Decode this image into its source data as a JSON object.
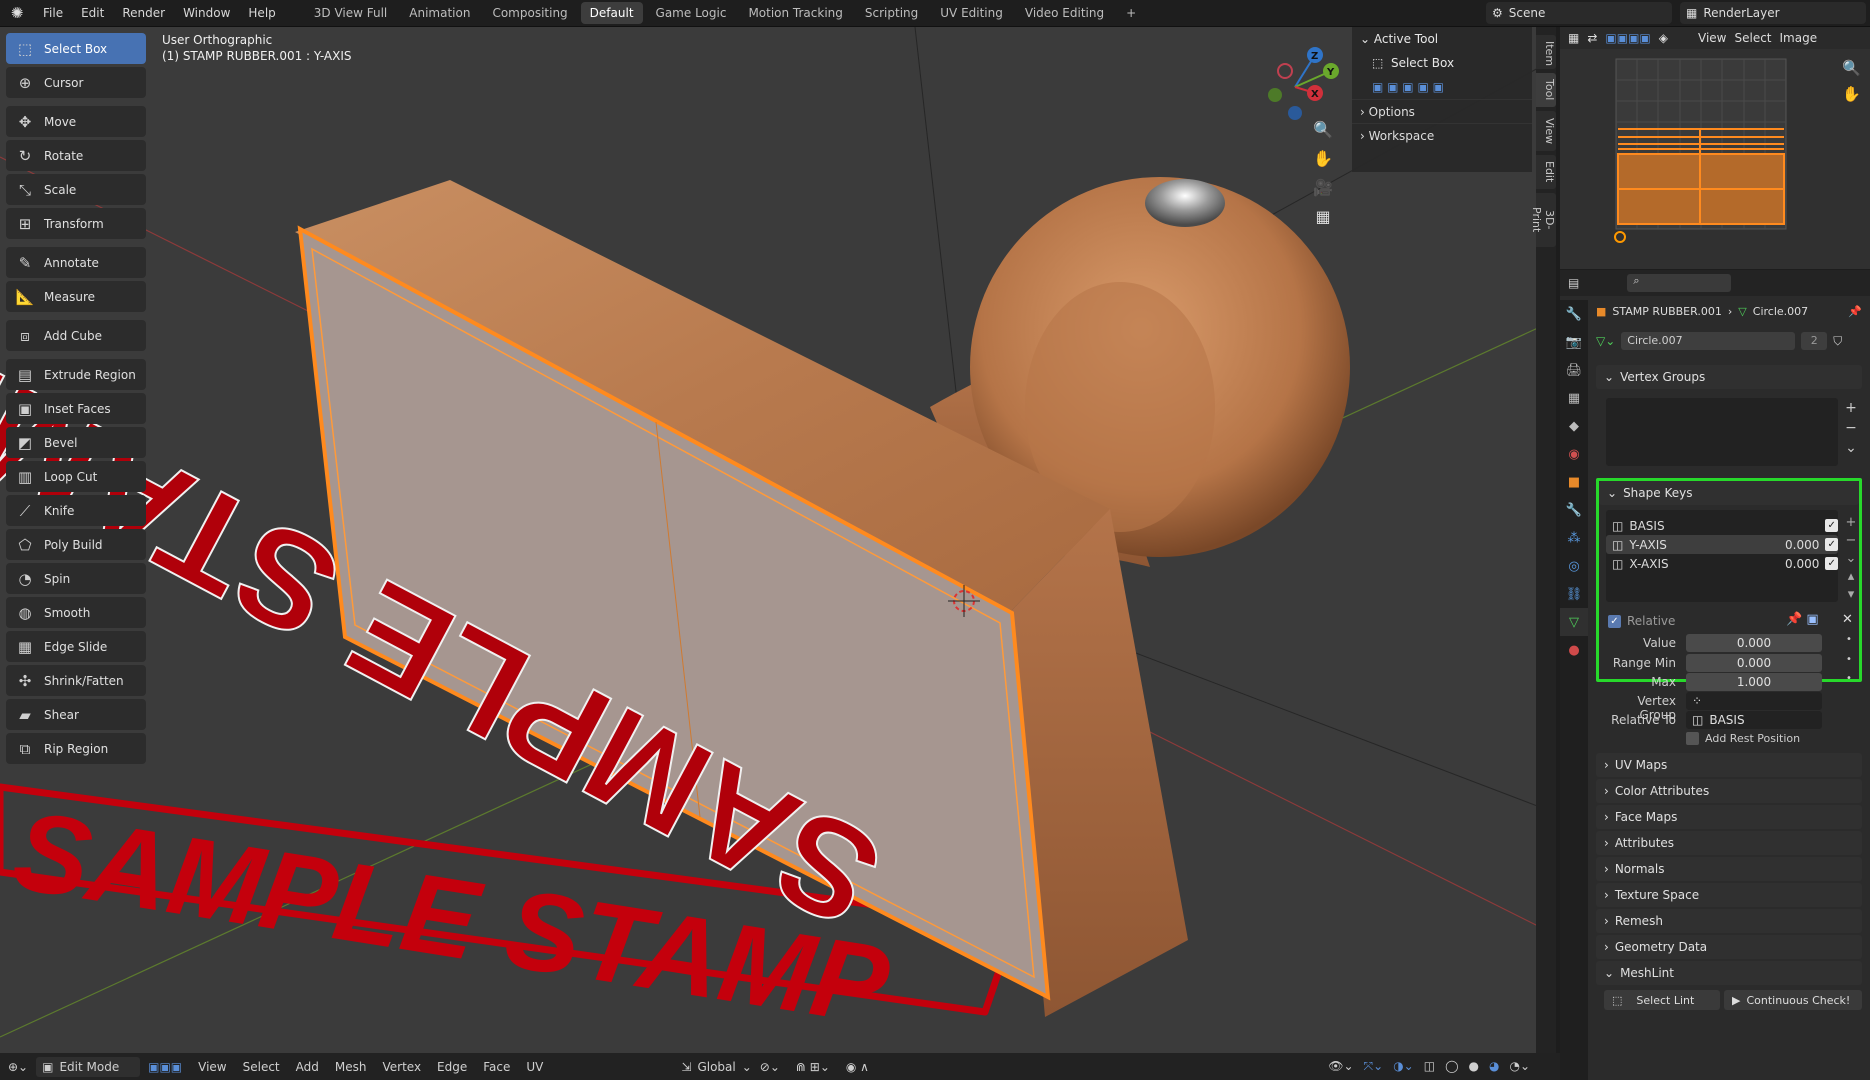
{
  "topbar": {
    "menus": [
      "File",
      "Edit",
      "Render",
      "Window",
      "Help"
    ],
    "workspaces": [
      "3D View Full",
      "Animation",
      "Compositing",
      "Default",
      "Game Logic",
      "Motion Tracking",
      "Scripting",
      "UV Editing",
      "Video Editing"
    ],
    "active_workspace": "Default",
    "add_tab": "+",
    "scene": "Scene",
    "render_layer": "RenderLayer"
  },
  "toolbar": {
    "tools": [
      "Select Box",
      "Cursor",
      "Move",
      "Rotate",
      "Scale",
      "Transform",
      "Annotate",
      "Measure",
      "Add Cube",
      "Extrude Region",
      "Inset Faces",
      "Bevel",
      "Loop Cut",
      "Knife",
      "Poly Build",
      "Spin",
      "Smooth",
      "Edge Slide",
      "Shrink/Fatten",
      "Shear",
      "Rip Region"
    ]
  },
  "viewport": {
    "view_name": "User Orthographic",
    "object_info": "(1) STAMP RUBBER.001 : Y-AXIS",
    "embossed_text": "SAMPLE STAMP",
    "ground_text": "SAMPLE STAMP",
    "gizmo": {
      "x": "X",
      "y": "Y",
      "z": "Z"
    }
  },
  "npanel": {
    "active_tool": "Active Tool",
    "tool_name": "Select Box",
    "options": "Options",
    "workspace": "Workspace"
  },
  "vtabs": [
    "Item",
    "Tool",
    "View",
    "Edit",
    "3D-Print"
  ],
  "uv": {
    "menus": [
      "View",
      "Select",
      "Image"
    ]
  },
  "props": {
    "breadcrumb_object": "STAMP RUBBER.001",
    "breadcrumb_mesh": "Circle.007",
    "mesh_name": "Circle.007",
    "mesh_users": "2",
    "vertex_groups": "Vertex Groups",
    "shape_keys": "Shape Keys",
    "keys": [
      {
        "name": "BASIS",
        "value": ""
      },
      {
        "name": "Y-AXIS",
        "value": "0.000"
      },
      {
        "name": "X-AXIS",
        "value": "0.000"
      }
    ],
    "relative": "Relative",
    "value_label": "Value",
    "value": "0.000",
    "range_min_label": "Range Min",
    "range_min": "0.000",
    "max_label": "Max",
    "max": "1.000",
    "vertex_group_label": "Vertex Group",
    "relative_to_label": "Relative To",
    "relative_to": "BASIS",
    "add_rest": "Add Rest Position",
    "panels": [
      "UV Maps",
      "Color Attributes",
      "Face Maps",
      "Attributes",
      "Normals",
      "Texture Space",
      "Remesh",
      "Geometry Data",
      "MeshLint"
    ],
    "select_lint": "Select Lint",
    "continuous_check": "Continuous Check!"
  },
  "statusbar": {
    "mode": "Edit Mode",
    "menus": [
      "View",
      "Select",
      "Add",
      "Mesh",
      "Vertex",
      "Edge",
      "Face",
      "UV"
    ],
    "orientation": "Global"
  },
  "colors": {
    "highlight": "#27d92b",
    "selection": "#ff8a1e",
    "stamp_red": "#b0000a"
  }
}
